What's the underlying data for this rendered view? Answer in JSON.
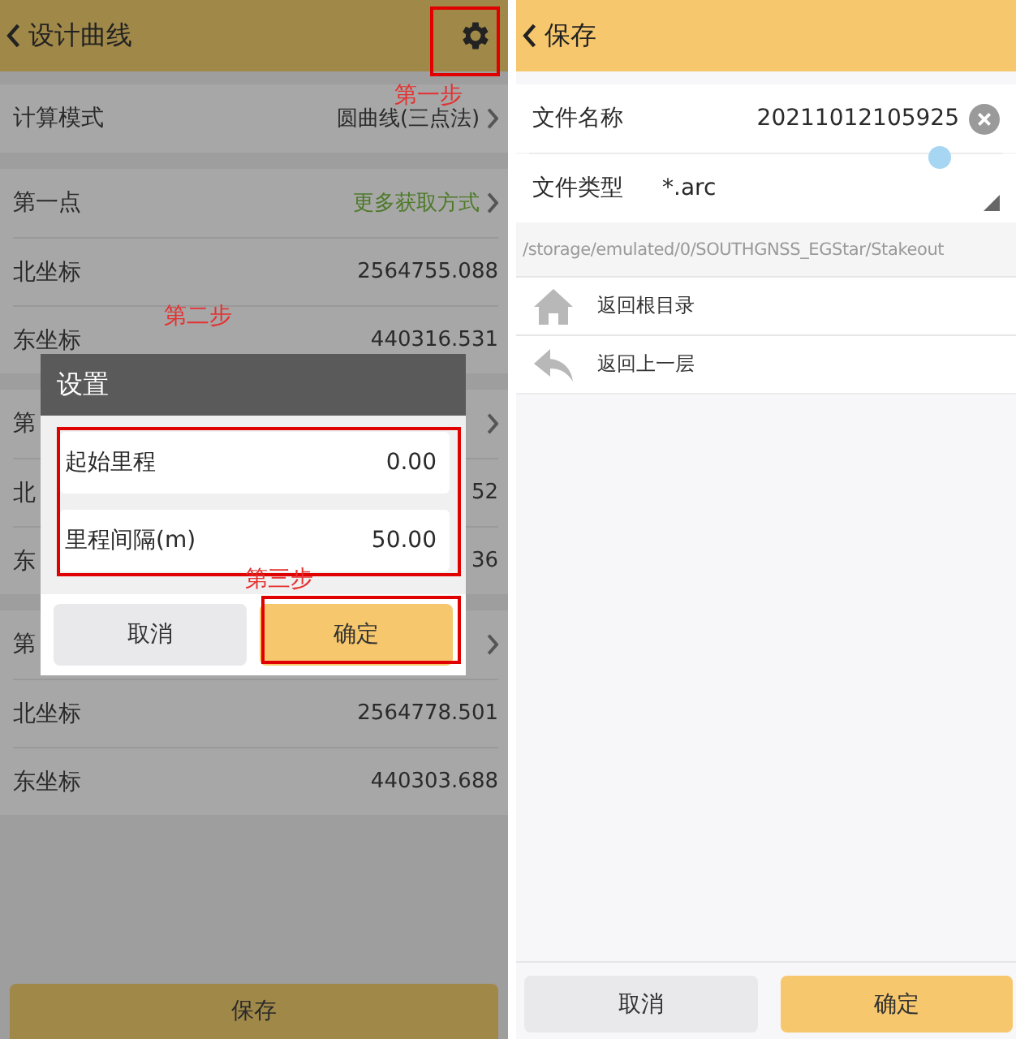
{
  "left_screen": {
    "title": "设计曲线",
    "groups": [
      [
        {
          "label": "计算模式",
          "value": "圆曲线(三点法)",
          "kind": "select"
        }
      ],
      [
        {
          "label": "第一点",
          "value": "更多获取方式",
          "kind": "link"
        },
        {
          "label": "北坐标",
          "value": "2564755.088",
          "kind": "value"
        },
        {
          "label": "东坐标",
          "value": "440316.531",
          "kind": "value"
        }
      ],
      [
        {
          "label": "第",
          "kind": "link"
        },
        {
          "label": "北",
          "value": "52",
          "kind": "value"
        },
        {
          "label": "东",
          "value": "36",
          "kind": "value"
        }
      ],
      [
        {
          "label": "第",
          "kind": "link"
        },
        {
          "label": "北坐标",
          "value": "2564778.501",
          "kind": "value"
        },
        {
          "label": "东坐标",
          "value": "440303.688",
          "kind": "value"
        }
      ]
    ],
    "save_button": "保存",
    "dialog": {
      "title": "设置",
      "fields": [
        {
          "label": "起始里程",
          "value": "0.00"
        },
        {
          "label": "里程间隔(m)",
          "value": "50.00"
        }
      ],
      "buttons": [
        {
          "label": "取消",
          "kind": "secondary"
        },
        {
          "label": "确定",
          "kind": "primary"
        }
      ]
    }
  },
  "annotations": [
    {
      "text": "第一步"
    },
    {
      "text": "第二步"
    },
    {
      "text": "第三步"
    }
  ],
  "right_screen": {
    "title": "保存",
    "file_name": {
      "label": "文件名称",
      "value": "20211012105925"
    },
    "file_type": {
      "label": "文件类型",
      "value": "*.arc"
    },
    "path": "/storage/emulated/0/SOUTHGNSS_EGStar/Stakeout",
    "nav_items": [
      {
        "label": "返回根目录",
        "kind": "home"
      },
      {
        "label": "返回上一层",
        "kind": "up"
      }
    ],
    "buttons": [
      {
        "label": "取消",
        "kind": "secondary"
      },
      {
        "label": "确定",
        "kind": "primary"
      }
    ]
  }
}
